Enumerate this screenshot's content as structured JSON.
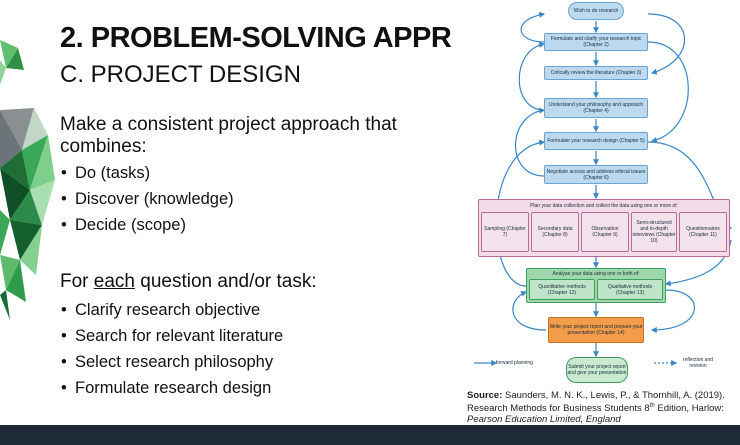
{
  "slide": {
    "title": "2. PROBLEM-SOLVING APPR",
    "subtitle": "C. PROJECT DESIGN",
    "intro": "Make a consistent project approach that combines:",
    "combines": [
      "Do (tasks)",
      "Discover (knowledge)",
      "Decide (scope)"
    ],
    "for_prefix": "For ",
    "for_each": "each",
    "for_suffix": " question and/or task:",
    "steps": [
      "Clarify research objective",
      "Search for relevant literature",
      "Select research philosophy",
      "Formulate research design"
    ]
  },
  "flowchart": {
    "start": "Wish to do research",
    "blue_steps": [
      "Formulate and clarify your research topic (Chapter 2)",
      "Critically review the literature (Chapter 3)",
      "Understand your philosophy and approach (Chapter 4)",
      "Formulate your research design (Chapter 5)",
      "Negotiate access and address ethical issues (Chapter 6)"
    ],
    "plan_header": "Plan your data collection and collect the data using one or more of:",
    "plan_cells": [
      "Sampling (Chapter 7)",
      "Secondary data (Chapter 8)",
      "Observation (Chapter 9)",
      "Semi-structured and in-depth interviews (Chapter 10)",
      "Questionnaires (Chapter 11)"
    ],
    "analyse_header": "Analyse your data using one or both of:",
    "analyse_cells": [
      "Quantitative methods (Chapter 12)",
      "Qualitative methods (Chapter 13)"
    ],
    "report": "Write your project report and prepare your presentation (Chapter 14)",
    "submit": "Submit your project report and give your presentation",
    "legend_forward": "forward planning",
    "legend_reflection": "reflection and revision"
  },
  "source": {
    "label": "Source:",
    "line1": " Saunders, M. N. K., Lewis, P., & Thornhill, A. (2019).",
    "line2a": "Research Methods for Business Students 8",
    "line2sup": "th",
    "line2b": " Edition, Harlow:",
    "line3": "Pearson Education Limited, England"
  },
  "colors": {
    "blue_box": "#bcd9f0",
    "pink_box": "#f1dbe8",
    "green_box": "#9fd7ad",
    "orange_box": "#f39c4a",
    "arrow_blue": "#3a87c8",
    "bottom_bar": "#1e2a36",
    "deco_green": "#3aa856"
  }
}
